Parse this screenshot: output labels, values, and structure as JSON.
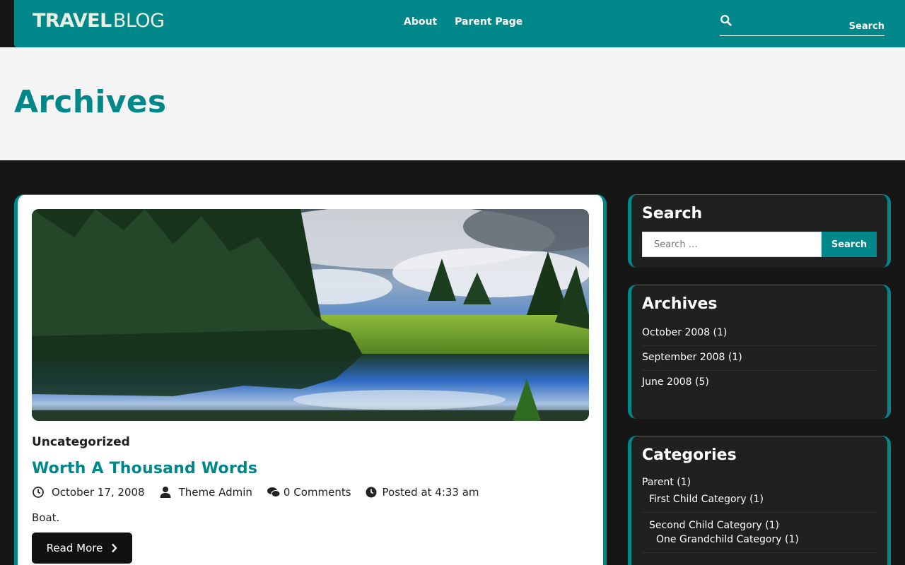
{
  "header": {
    "logo_primary": "TRAVEL",
    "logo_secondary": "BLOG",
    "nav": [
      {
        "label": "About"
      },
      {
        "label": "Parent Page"
      }
    ],
    "search_button": "Search"
  },
  "page": {
    "title": "Archives"
  },
  "post": {
    "category": "Uncategorized",
    "title": "Worth A Thousand Words",
    "date": "October 17, 2008",
    "author": "Theme Admin",
    "comments": "0 Comments",
    "posted_at": "Posted at 4:33 am",
    "excerpt": "Boat.",
    "read_more": "Read More"
  },
  "sidebar": {
    "search": {
      "title": "Search",
      "placeholder": "Search …",
      "button": "Search"
    },
    "archives": {
      "title": "Archives",
      "items": [
        "October 2008 (1)",
        "September 2008 (1)",
        "June 2008 (5)"
      ]
    },
    "categories": {
      "title": "Categories",
      "items": [
        "Parent (1)",
        "First Child Category (1)",
        "Second Child Category (1)",
        "One Grandchild Category (1)"
      ]
    }
  },
  "colors": {
    "accent": "#00878a",
    "dark": "#161616",
    "widget": "#202020"
  }
}
